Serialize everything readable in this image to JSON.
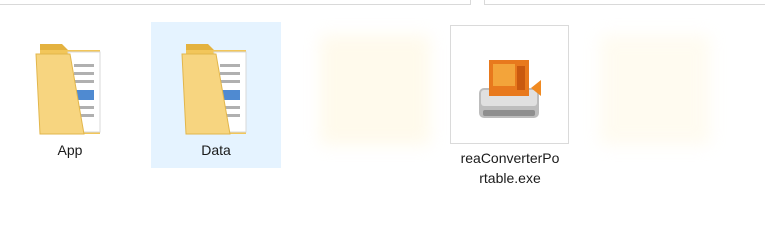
{
  "explorer": {
    "items": [
      {
        "name": "App",
        "type": "folder",
        "selected": false
      },
      {
        "name": "Data",
        "type": "folder",
        "selected": true
      },
      {
        "name": "reaConverterPortable.exe",
        "label_line1": "reaConverterPo",
        "label_line2": "rtable.exe",
        "type": "exe",
        "selected": false
      }
    ]
  },
  "colors": {
    "selection_bg": "#e5f3ff",
    "folder_yellow": "#f5cf6b",
    "folder_dark": "#e4b23f",
    "exe_orange": "#e8791d"
  },
  "icons": {
    "folder": "folder-icon",
    "exe": "reaconverter-app-icon"
  }
}
